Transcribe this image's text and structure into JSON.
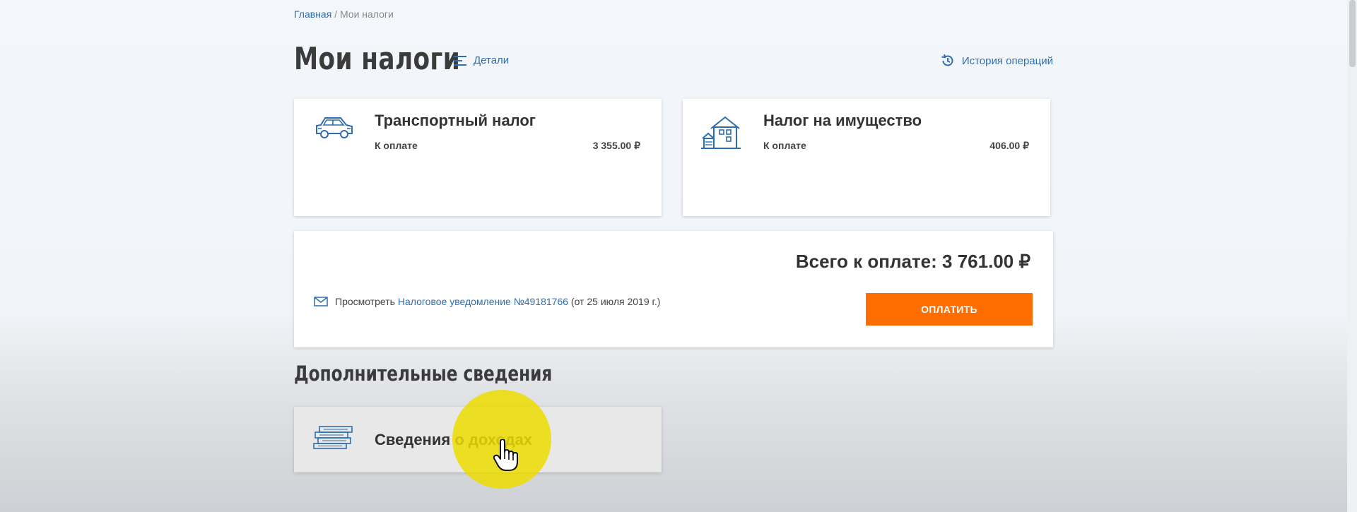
{
  "breadcrumb": {
    "home": "Главная",
    "separator": " / ",
    "current": "Мои налоги"
  },
  "header": {
    "title": "Мои налоги",
    "details_label": "Детали",
    "history_label": "История операций"
  },
  "taxes": [
    {
      "name": "Транспортный налог",
      "pay_label": "К оплате",
      "amount": "3 355.00 ₽",
      "icon": "car-icon"
    },
    {
      "name": "Налог на имущество",
      "pay_label": "К оплате",
      "amount": "406.00 ₽",
      "icon": "house-icon"
    }
  ],
  "summary": {
    "total": "Всего к оплате: 3 761.00 ₽",
    "notice_prefix": "Просмотреть ",
    "notice_link": "Налоговое уведомление №49181766",
    "notice_suffix": " (от 25 июля 2019 г.)",
    "pay_button": "ОПЛАТИТЬ"
  },
  "additional": {
    "title": "Дополнительные сведения",
    "income_label": "Сведения о доходах",
    "income_icon": "money-stack-icon"
  },
  "colors": {
    "accent": "#2f6eae",
    "pay_button": "#ff6d00",
    "highlight": "#ecdc00"
  }
}
